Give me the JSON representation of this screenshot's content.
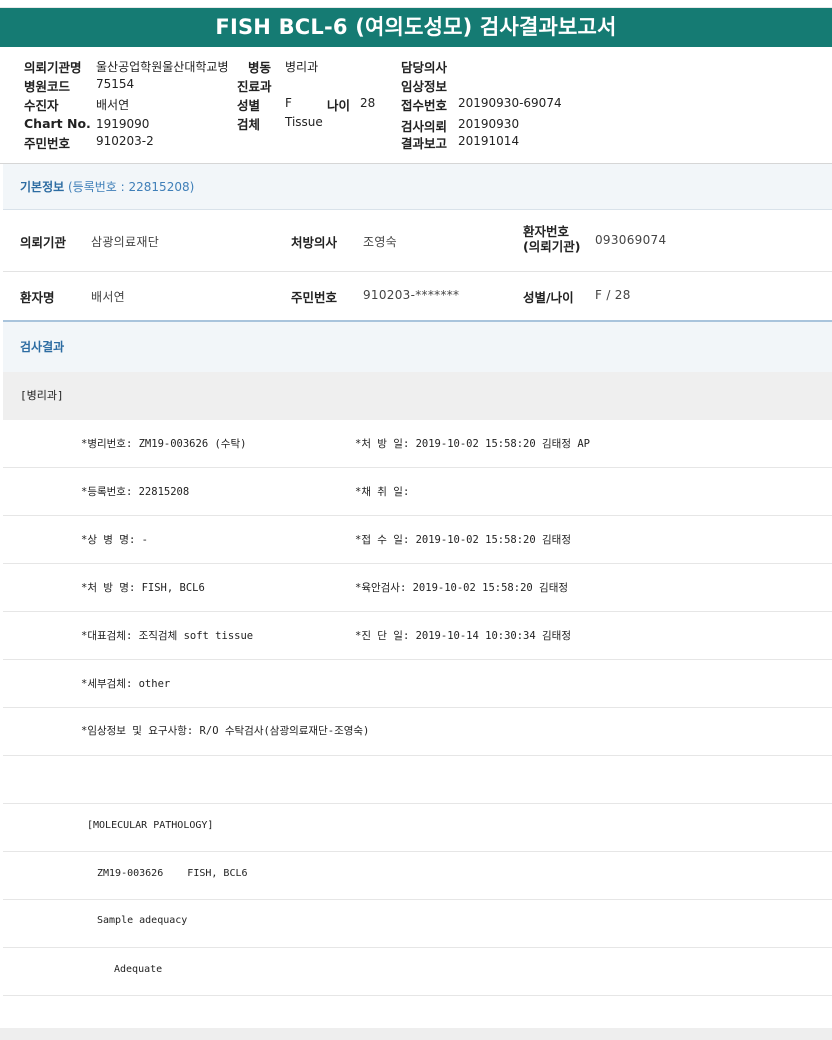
{
  "title": "FISH BCL-6 (여의도성모) 검사결과보고서",
  "header": {
    "institution_label": "의뢰기관명",
    "institution_value": "울산공업학원울산대학교병",
    "ward_label": "병동",
    "ward_value": "병리과",
    "doctor_label": "담당의사",
    "doctor_value": "",
    "hospital_code_label": "병원코드",
    "hospital_code_value": "75154",
    "dept_label": "진료과",
    "dept_value": "",
    "clinical_label": "임상정보",
    "clinical_value": "",
    "patient_label": "수진자",
    "patient_value": "배서연",
    "sex_label": "성별",
    "sex_value": "F",
    "age_label": "나이",
    "age_value": "28",
    "receipt_label": "접수번호",
    "receipt_value": "20190930-69074",
    "chart_label": "Chart No.",
    "chart_value": "1919090",
    "specimen_label": "검체",
    "specimen_value": "Tissue",
    "request_label": "검사의뢰",
    "request_value": "20190930",
    "resident_label": "주민번호",
    "resident_value": "910203-2",
    "report_label": "결과보고",
    "report_value": "20191014"
  },
  "basic": {
    "heading": "기본정보",
    "reg_text": "(등록번호 : 22815208)",
    "inst_label": "의뢰기관",
    "inst_value": "삼광의료재단",
    "doctor_label": "처방의사",
    "doctor_value": "조영숙",
    "pid_label_1": "환자번호",
    "pid_label_2": "(의뢰기관)",
    "pid_value": "093069074",
    "name_label": "환자명",
    "name_value": "배서연",
    "resident_label": "주민번호",
    "resident_value": "910203-*******",
    "sexage_label": "성별/나이",
    "sexage_value": "F / 28"
  },
  "result": {
    "heading": "검사결과",
    "dept": "[병리과]",
    "lines": [
      {
        "left": "*병리번호: ZM19-003626 (수탁)",
        "right": "*처 방 일: 2019-10-02 15:58:20  김태정 AP"
      },
      {
        "left": "*등록번호: 22815208",
        "right": "*채 취 일:"
      },
      {
        "left": "*상 병 명: -",
        "right": "*접 수 일: 2019-10-02 15:58:20  김태정"
      },
      {
        "left": "*처 방 명: FISH, BCL6",
        "right": "*육안검사: 2019-10-02 15:58:20  김태정"
      },
      {
        "left": "*대표검체: 조직검체 soft tissue",
        "right": "*진 단 일: 2019-10-14 10:30:34  김태정"
      },
      {
        "left": "*세부검체: other",
        "right": ""
      },
      {
        "left": "*임상정보 및 요구사항: R/O 수탁검사(삼광의료재단-조영숙)",
        "right": ""
      }
    ],
    "mp_heading": "[MOLECULAR PATHOLOGY]",
    "mp_line": "ZM19-003626    FISH, BCL6",
    "adequacy_label": "Sample adequacy",
    "adequacy_value": "Adequate"
  }
}
